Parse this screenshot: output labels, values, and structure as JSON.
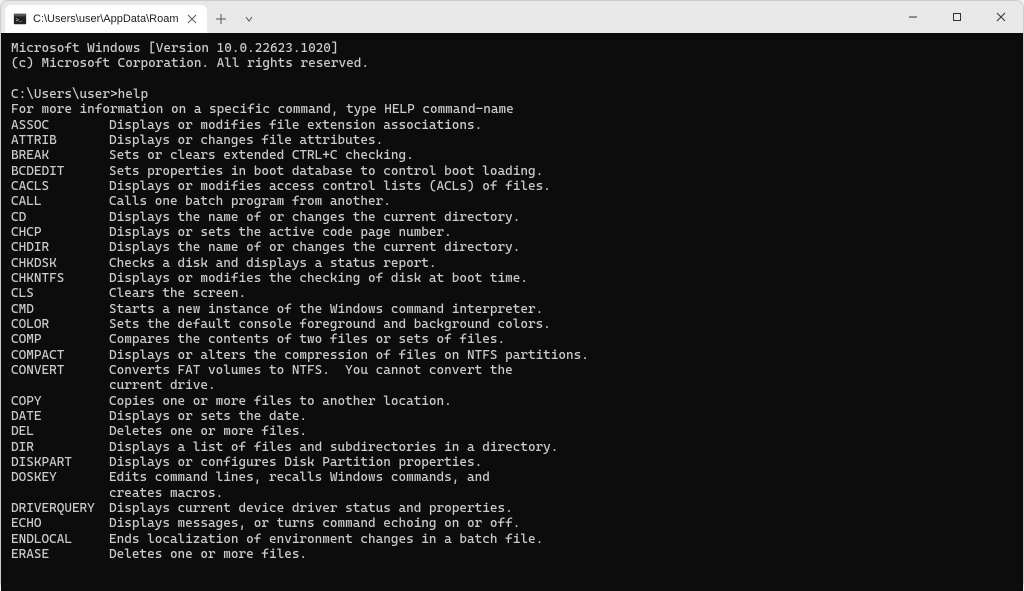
{
  "titlebar": {
    "tab": {
      "title": "C:\\Users\\user\\AppData\\Roam"
    }
  },
  "terminal": {
    "banner_line1": "Microsoft Windows [Version 10.0.22623.1020]",
    "banner_line2": "(c) Microsoft Corporation. All rights reserved.",
    "prompt": "C:\\Users\\user>",
    "command": "help",
    "help_header": "For more information on a specific command, type HELP command-name",
    "commands": [
      {
        "name": "ASSOC",
        "desc": "Displays or modifies file extension associations."
      },
      {
        "name": "ATTRIB",
        "desc": "Displays or changes file attributes."
      },
      {
        "name": "BREAK",
        "desc": "Sets or clears extended CTRL+C checking."
      },
      {
        "name": "BCDEDIT",
        "desc": "Sets properties in boot database to control boot loading."
      },
      {
        "name": "CACLS",
        "desc": "Displays or modifies access control lists (ACLs) of files."
      },
      {
        "name": "CALL",
        "desc": "Calls one batch program from another."
      },
      {
        "name": "CD",
        "desc": "Displays the name of or changes the current directory."
      },
      {
        "name": "CHCP",
        "desc": "Displays or sets the active code page number."
      },
      {
        "name": "CHDIR",
        "desc": "Displays the name of or changes the current directory."
      },
      {
        "name": "CHKDSK",
        "desc": "Checks a disk and displays a status report."
      },
      {
        "name": "CHKNTFS",
        "desc": "Displays or modifies the checking of disk at boot time."
      },
      {
        "name": "CLS",
        "desc": "Clears the screen."
      },
      {
        "name": "CMD",
        "desc": "Starts a new instance of the Windows command interpreter."
      },
      {
        "name": "COLOR",
        "desc": "Sets the default console foreground and background colors."
      },
      {
        "name": "COMP",
        "desc": "Compares the contents of two files or sets of files."
      },
      {
        "name": "COMPACT",
        "desc": "Displays or alters the compression of files on NTFS partitions."
      },
      {
        "name": "CONVERT",
        "desc": "Converts FAT volumes to NTFS.  You cannot convert the",
        "cont": "current drive."
      },
      {
        "name": "COPY",
        "desc": "Copies one or more files to another location."
      },
      {
        "name": "DATE",
        "desc": "Displays or sets the date."
      },
      {
        "name": "DEL",
        "desc": "Deletes one or more files."
      },
      {
        "name": "DIR",
        "desc": "Displays a list of files and subdirectories in a directory."
      },
      {
        "name": "DISKPART",
        "desc": "Displays or configures Disk Partition properties."
      },
      {
        "name": "DOSKEY",
        "desc": "Edits command lines, recalls Windows commands, and",
        "cont": "creates macros."
      },
      {
        "name": "DRIVERQUERY",
        "desc": "Displays current device driver status and properties."
      },
      {
        "name": "ECHO",
        "desc": "Displays messages, or turns command echoing on or off."
      },
      {
        "name": "ENDLOCAL",
        "desc": "Ends localization of environment changes in a batch file."
      },
      {
        "name": "ERASE",
        "desc": "Deletes one or more files."
      }
    ]
  }
}
